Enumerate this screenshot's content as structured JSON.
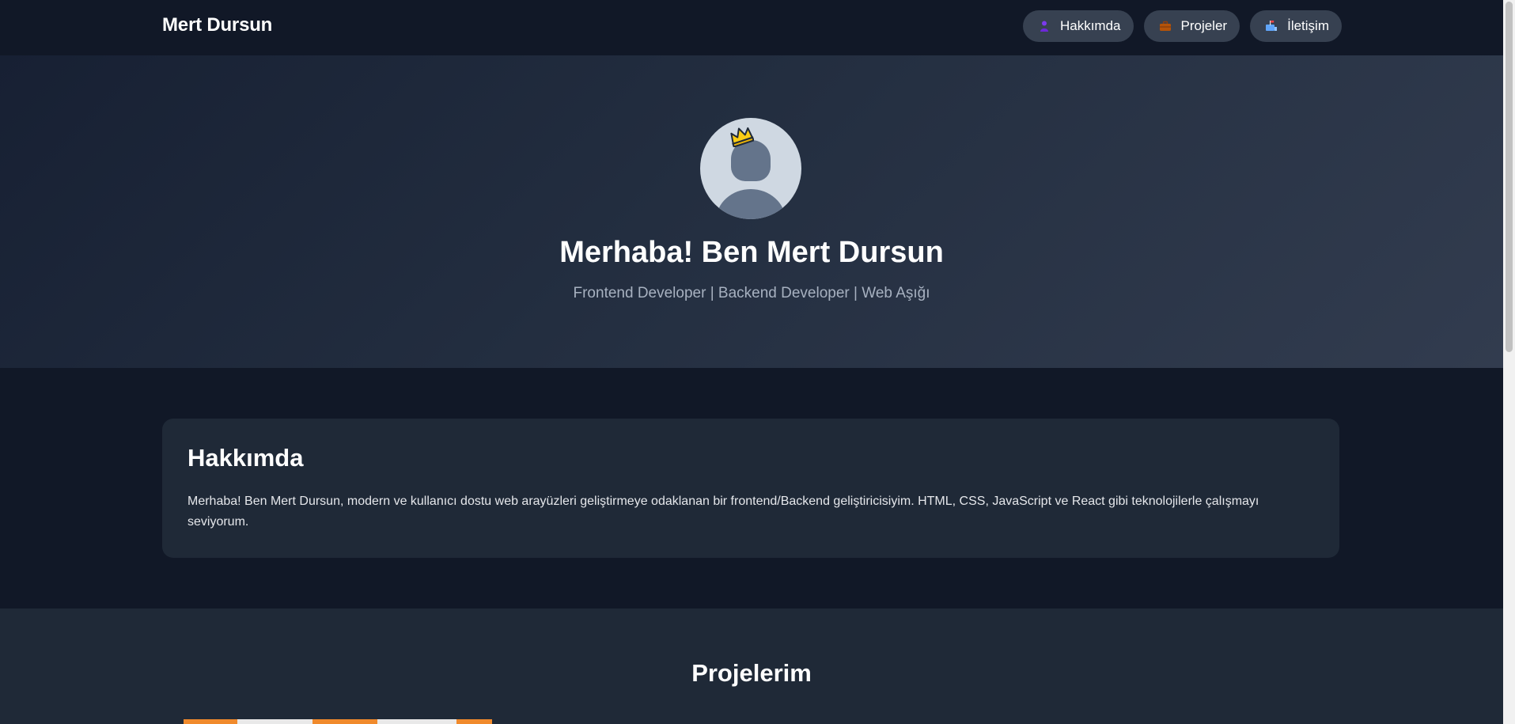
{
  "header": {
    "brand": "Mert Dursun",
    "nav": [
      {
        "label": "Hakkımda",
        "icon": "person-icon"
      },
      {
        "label": "Projeler",
        "icon": "briefcase-icon"
      },
      {
        "label": "İletişim",
        "icon": "mailbox-icon"
      }
    ]
  },
  "hero": {
    "title": "Merhaba! Ben Mert Dursun",
    "subtitle": "Frontend Developer | Backend Developer | Web Aşığı",
    "avatar_icon": "avatar-placeholder-icon",
    "crown_icon": "crown-icon"
  },
  "about": {
    "title": "Hakkımda",
    "text": "Merhaba! Ben Mert Dursun, modern ve kullanıcı dostu web arayüzleri geliştirmeye odaklanan bir frontend/Backend geliştiricisiyim. HTML, CSS, JavaScript ve React gibi teknolojilerle çalışmayı seviyorum."
  },
  "projects": {
    "title": "Projelerim"
  },
  "colors": {
    "background": "#111827",
    "card": "#1f2937",
    "nav_button": "#374151",
    "accent_orange": "#f08a2c"
  }
}
